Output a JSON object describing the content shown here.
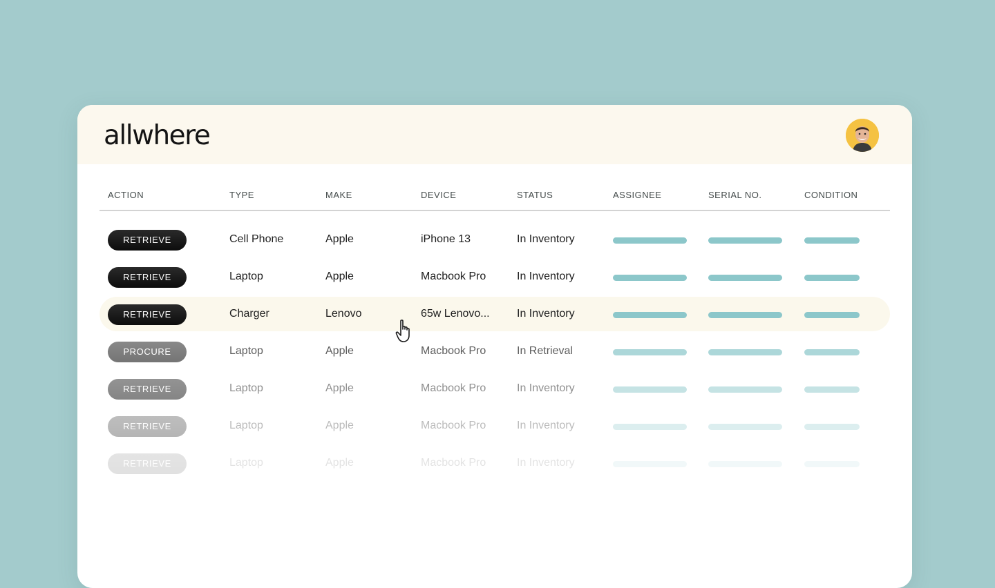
{
  "app": {
    "logo": "allwhere"
  },
  "header": {
    "avatar_icon": "user-avatar"
  },
  "table": {
    "columns": [
      "ACTION",
      "TYPE",
      "MAKE",
      "DEVICE",
      "STATUS",
      "ASSIGNEE",
      "SERIAL NO.",
      "CONDITION"
    ],
    "rows": [
      {
        "action": "RETRIEVE",
        "type": "Cell Phone",
        "make": "Apple",
        "device": "iPhone 13",
        "status": "In Inventory"
      },
      {
        "action": "RETRIEVE",
        "type": "Laptop",
        "make": "Apple",
        "device": "Macbook Pro",
        "status": "In Inventory"
      },
      {
        "action": "RETRIEVE",
        "type": "Charger",
        "make": "Lenovo",
        "device": "65w Lenovo...",
        "status": "In Inventory"
      },
      {
        "action": "PROCURE",
        "type": "Laptop",
        "make": "Apple",
        "device": "Macbook Pro",
        "status": "In Retrieval"
      },
      {
        "action": "RETRIEVE",
        "type": "Laptop",
        "make": "Apple",
        "device": "Macbook Pro",
        "status": "In Inventory"
      },
      {
        "action": "RETRIEVE",
        "type": "Laptop",
        "make": "Apple",
        "device": "Macbook Pro",
        "status": "In Inventory"
      },
      {
        "action": "RETRIEVE",
        "type": "Laptop",
        "make": "Apple",
        "device": "Macbook Pro",
        "status": "In Inventory"
      }
    ]
  },
  "colors": {
    "background": "#a3cbcc",
    "header_bg": "#fcf8ee",
    "placeholder_bar": "#8cc7ca",
    "pill": "#141414",
    "avatar_ring": "#f5c242"
  },
  "cursor_icon": "hand-pointer-icon"
}
